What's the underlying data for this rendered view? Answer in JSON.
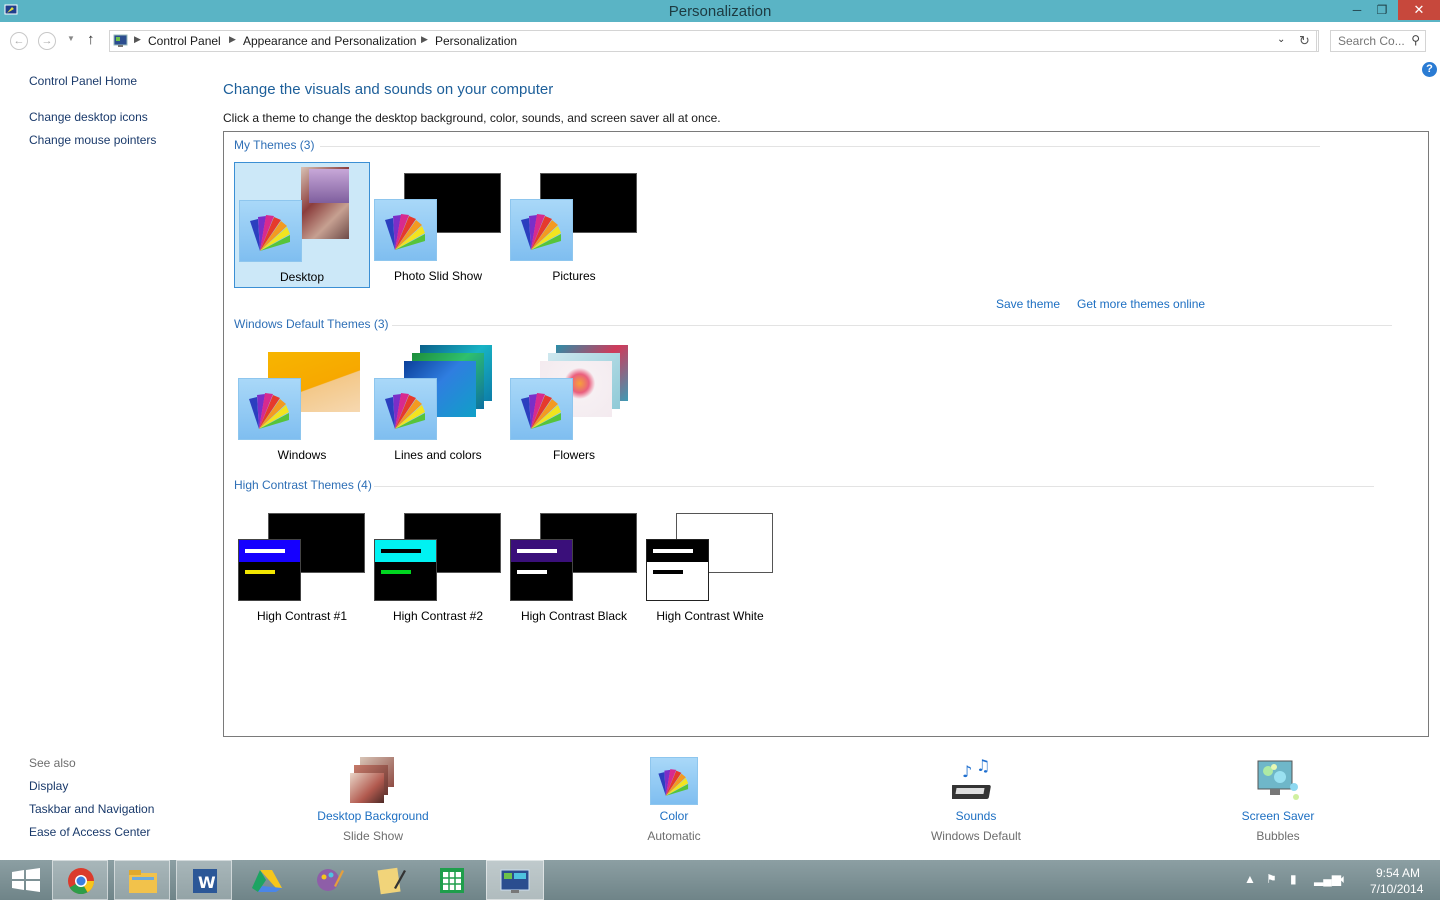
{
  "window": {
    "title": "Personalization",
    "minimize_icon": "minimize-icon",
    "restore_icon": "restore-icon",
    "close_icon": "close-icon"
  },
  "address": {
    "crumbs": [
      "Control Panel",
      "Appearance and Personalization",
      "Personalization"
    ],
    "search_placeholder": "Search Co..."
  },
  "left": {
    "links": [
      "Control Panel Home",
      "Change desktop icons",
      "Change mouse pointers"
    ],
    "see_also_header": "See also",
    "see_also": [
      "Display",
      "Taskbar and Navigation",
      "Ease of Access Center"
    ]
  },
  "main": {
    "heading": "Change the visuals and sounds on your computer",
    "description": "Click a theme to change the desktop background, color, sounds, and screen saver all at once.",
    "save_theme": "Save theme",
    "get_more": "Get more themes online",
    "groups": [
      {
        "header": "My Themes (3)",
        "themes": [
          "Desktop",
          "Photo Slid Show",
          "Pictures"
        ],
        "selected": "Desktop"
      },
      {
        "header": "Windows Default Themes (3)",
        "themes": [
          "Windows",
          "Lines and colors",
          "Flowers"
        ]
      },
      {
        "header": "High Contrast Themes (4)",
        "themes": [
          "High Contrast #1",
          "High Contrast #2",
          "High Contrast Black",
          "High Contrast White"
        ]
      }
    ]
  },
  "bottom": [
    {
      "label": "Desktop Background",
      "sub": "Slide Show"
    },
    {
      "label": "Color",
      "sub": "Automatic"
    },
    {
      "label": "Sounds",
      "sub": "Windows Default"
    },
    {
      "label": "Screen Saver",
      "sub": "Bubbles"
    }
  ],
  "taskbar": {
    "apps": [
      "windows-start-icon",
      "chrome-icon",
      "file-explorer-icon",
      "word-icon",
      "google-drive-icon",
      "paint-icon",
      "notepad-icon",
      "spreadsheet-icon",
      "control-panel-icon"
    ],
    "time": "9:54 AM",
    "date": "7/10/2014"
  },
  "colors": {
    "titlebar": "#5ab4c5",
    "link": "#1d6fc2",
    "heading": "#1d5f9a",
    "close": "#c7483c"
  }
}
